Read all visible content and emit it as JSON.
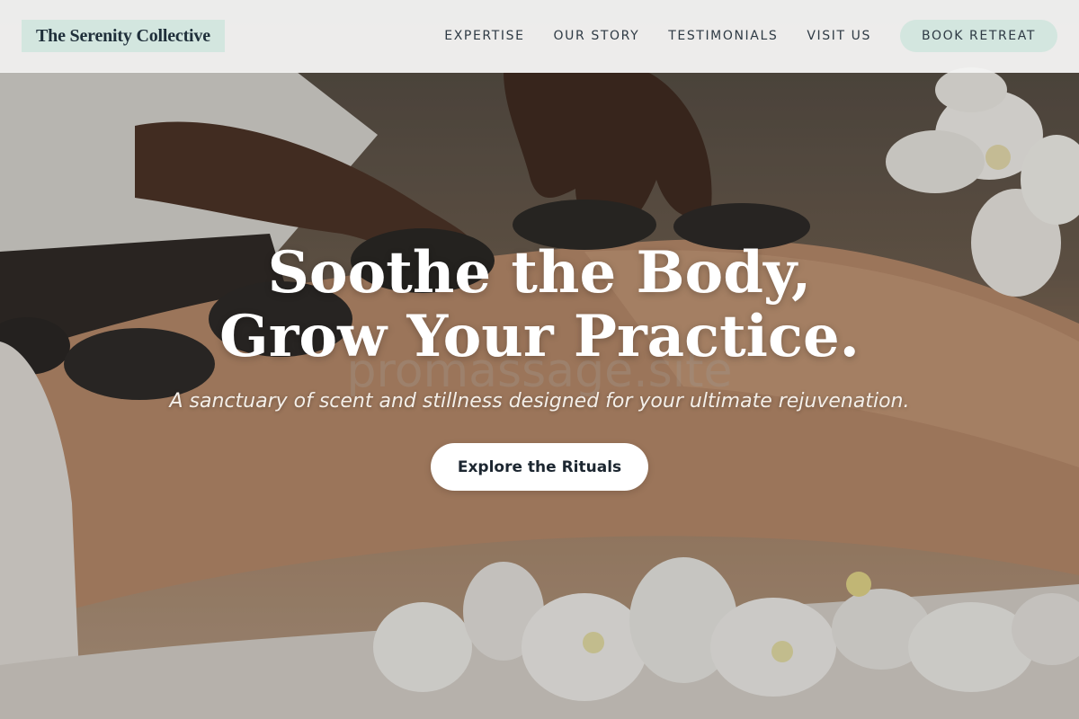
{
  "header": {
    "logo": "The Serenity Collective",
    "nav": [
      "EXPERTISE",
      "OUR STORY",
      "TESTIMONIALS",
      "VISIT US"
    ],
    "cta": "BOOK RETREAT"
  },
  "hero": {
    "headline_line1": "Soothe the Body,",
    "headline_line2": "Grow Your Practice.",
    "subheadline": "A sanctuary of scent and stillness designed for your ultimate rejuvenation.",
    "cta": "Explore the Rituals",
    "watermark": "promassage.site"
  },
  "colors": {
    "accent_mint": "#d3e6df",
    "nav_text": "#2e3a44",
    "hero_text": "#ffffff"
  }
}
